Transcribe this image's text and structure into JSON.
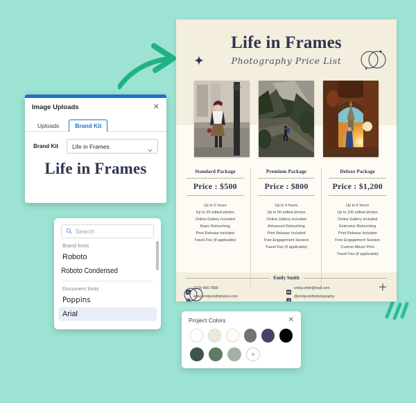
{
  "canvas": {
    "background_color": "#9ce3d4",
    "decorations": {
      "arrow": "curved-arrow-right",
      "strokes": "three-diagonal-strokes"
    }
  },
  "poster": {
    "background_color": "#f3eedd",
    "title": "Life in Frames",
    "subtitle": "Photography Price List",
    "sparkle_icon": "four-point-star-icon",
    "logo_icon": "two-overlapping-circles-icon",
    "plus_icon": "plus-icon",
    "photos": [
      {
        "name": "street-fashion-photo",
        "alt": "Woman in coat on city street by lamppost"
      },
      {
        "name": "mountain-hiker-photo",
        "alt": "Hiker on mountain trail with cliff"
      },
      {
        "name": "temple-sunset-photo",
        "alt": "Woman in archway with temple at sunset"
      }
    ],
    "packages": [
      {
        "name": "Standard Package",
        "price": "Price : $500",
        "features": [
          "Up to 2 hours",
          "Up to 20 edited photos",
          "Online Gallery Included",
          "Basic Retouching",
          "Print Release Included",
          "Travel Fee (if applicable)"
        ]
      },
      {
        "name": "Premium Package",
        "price": "Price : $800",
        "features": [
          "Up to 4 hours",
          "Up to 50 edited photos",
          "Online Gallery Included",
          "Advanced Retouching",
          "Print Release Included",
          "Free Engagement Session",
          "Travel Fee (if applicable)"
        ]
      },
      {
        "name": "Deluxe Package",
        "price": "Price : $1,200",
        "features": [
          "Up to 6 hours",
          "Up to 100 edited photos",
          "Online Gallery Included",
          "Extensive Retouching",
          "Print Release Included",
          "Free Engagement Session",
          "Custom Album Print",
          "Travel Fee (if applicable)"
        ]
      }
    ],
    "footer": {
      "name": "Emily Smith",
      "contacts": [
        {
          "icon": "phone-icon",
          "text": "(123) 456-7890"
        },
        {
          "icon": "globe-icon",
          "text": "www.emilysmithphotos.com"
        },
        {
          "icon": "mail-icon",
          "text": "emily.smith@mail.com"
        },
        {
          "icon": "instagram-icon",
          "text": "@emilysmithphotography"
        }
      ]
    }
  },
  "uploads_panel": {
    "accent_color": "#1a73c8",
    "title": "Image Uploads",
    "close_icon": "close-icon",
    "tabs": [
      {
        "label": "Uploads",
        "active": false
      },
      {
        "label": "Brand Kit",
        "active": true
      }
    ],
    "brand_kit": {
      "label": "Brand Kit",
      "selected": "Life in Frames",
      "chevron_icon": "chevron-down-icon",
      "preview_text": "Life in Frames"
    }
  },
  "fonts_panel": {
    "search_placeholder": "Search",
    "search_icon": "search-icon",
    "groups": [
      {
        "label": "Brand fonts",
        "items": [
          {
            "name": "Roboto",
            "selected": false
          },
          {
            "name": "Roboto Condensed",
            "selected": false
          }
        ]
      },
      {
        "label": "Document fonts",
        "items": [
          {
            "name": "Poppins",
            "selected": false
          },
          {
            "name": "Arial",
            "selected": true
          }
        ]
      }
    ]
  },
  "colors_panel": {
    "title": "Project Colors",
    "close_icon": "close-icon",
    "add_icon": "plus-icon",
    "row1": [
      "#ffffff",
      "#ece9d8",
      "#fdfbf2",
      "#6e747a",
      "#434566",
      "#000000"
    ],
    "row2": [
      "#3c5449",
      "#5d7b65",
      "#a5b0a6"
    ]
  }
}
